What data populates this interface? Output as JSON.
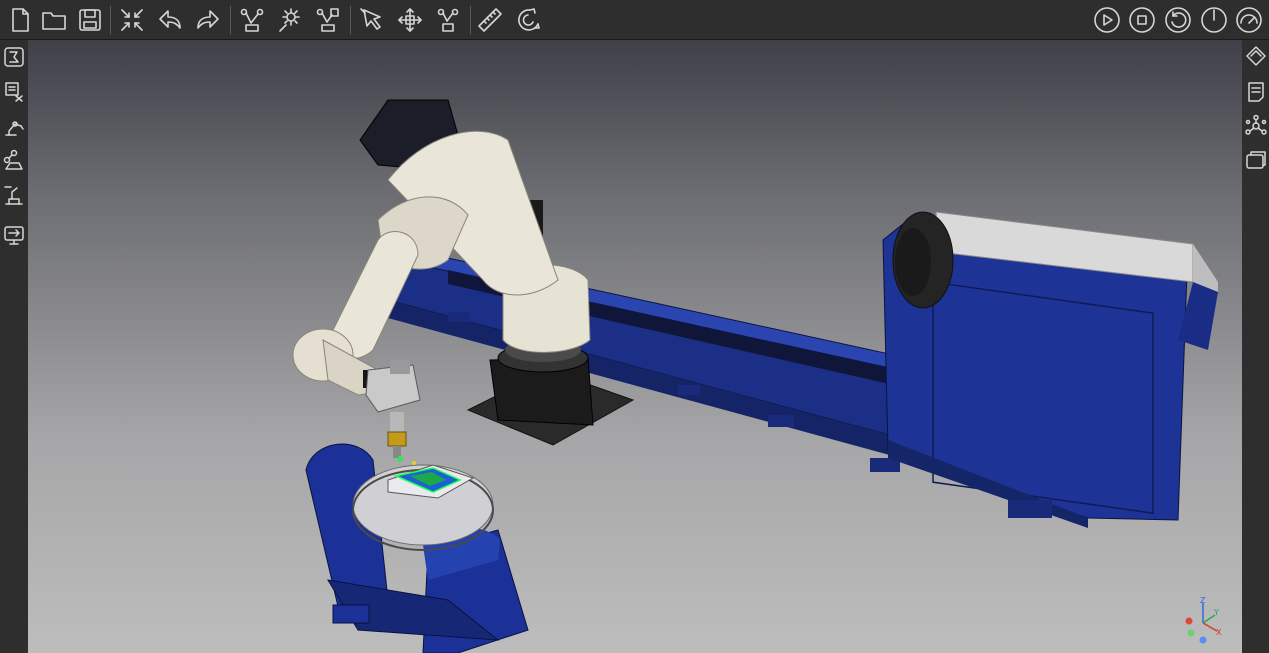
{
  "toolbar": {
    "file_tools": [
      "new-file-icon",
      "open-folder-icon",
      "save-icon"
    ],
    "edit_tools": [
      "fit-view-icon",
      "undo-icon",
      "redo-icon"
    ],
    "robot_tools": [
      "robot-path-icon",
      "gear-settings-icon",
      "robot-teach-icon"
    ],
    "select_tools": [
      "select-arrow-icon",
      "move-icon",
      "robot-move-icon"
    ],
    "measure_tools": [
      "ruler-icon",
      "magnet-icon"
    ],
    "simulation_controls": [
      "play-icon",
      "stop-icon",
      "reset-icon",
      "timer-icon",
      "gauge-icon"
    ]
  },
  "left_sidebar": {
    "items": [
      "library-icon",
      "program-list-icon",
      "robot-arm-icon",
      "network-icon",
      "station-icon",
      "export-icon"
    ]
  },
  "right_sidebar": {
    "items": [
      "properties-icon",
      "notes-icon",
      "hierarchy-icon",
      "display-icon"
    ]
  },
  "viewport": {
    "scene": "robot-welding-cell",
    "background_top": "#3f4048",
    "background_bottom": "#bdbdbd",
    "accent_blue": "#1f3a9a",
    "robot_color": "#e8e4d8",
    "triad_axes": {
      "x": "X",
      "y": "Y",
      "z": "Z"
    }
  }
}
